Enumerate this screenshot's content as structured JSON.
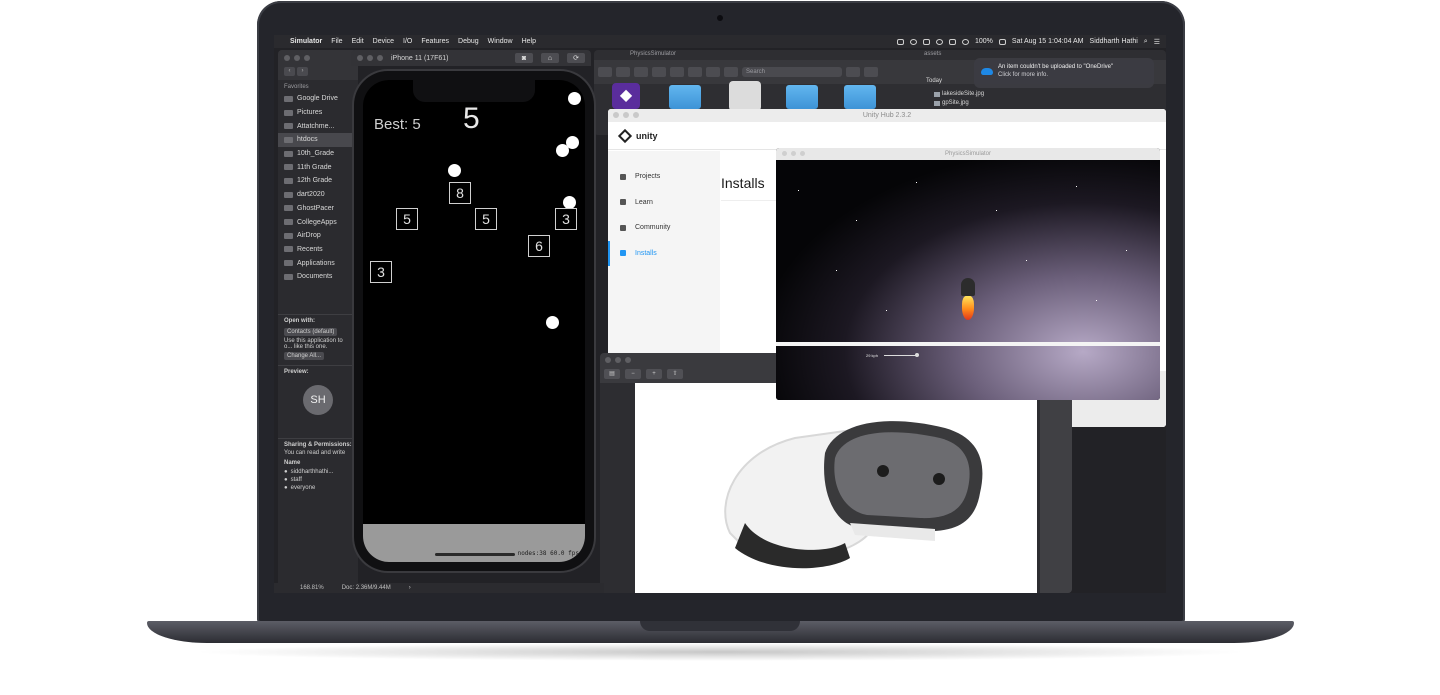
{
  "menubar": {
    "app_name": "Simulator",
    "items": [
      "File",
      "Edit",
      "Device",
      "I/O",
      "Features",
      "Debug",
      "Window",
      "Help"
    ],
    "battery": "100%",
    "datetime": "Sat Aug 15  1:04:04 AM",
    "user": "Siddharth Hathi"
  },
  "simulator": {
    "device_title": "iPhone 11 (17F61)",
    "game": {
      "score": "5",
      "best": "Best: 5",
      "boxes": [
        "8",
        "5",
        "5",
        "3",
        "6",
        "3"
      ],
      "nodes_readout": "nodes:38  60.0 fps"
    }
  },
  "finder_sidebar": {
    "heading": "Favorites",
    "items": [
      "Google Drive",
      "Pictures",
      "Attatchme...",
      "htdocs",
      "10th_Grade",
      "11th Grade",
      "12th Grade",
      "dart2020",
      "GhostPacer",
      "CollegeApps",
      "AirDrop",
      "Recents",
      "Applications",
      "Documents"
    ],
    "open_with_heading": "Open with:",
    "open_with_app": "Contacts (default)",
    "open_with_note": "Use this application to o... like this one.",
    "change_all": "Change All...",
    "preview_heading": "Preview:",
    "avatar_initials": "SH",
    "sharing_heading": "Sharing & Permissions:",
    "sharing_note": "You can read and write",
    "perm_column": "Name",
    "perm_rows": [
      "siddharthhathi...",
      "staff",
      "everyone"
    ]
  },
  "background_finder": {
    "title_physics": "PhysicsSimulator",
    "title_assets": "assets",
    "search_placeholder": "Search",
    "today_label": "Today",
    "files": [
      "lakesideSite.jpg",
      "gpSite.jpg"
    ]
  },
  "notification": {
    "title": "An item couldn't be uploaded to \"OneDrive\"",
    "subtitle": "Click for more info."
  },
  "unity_hub": {
    "window_title": "Unity Hub 2.3.2",
    "brand": "unity",
    "nav": [
      "Projects",
      "Learn",
      "Community",
      "Installs"
    ],
    "active_nav": "Installs",
    "page_title": "Installs"
  },
  "physics_simulator": {
    "window_title": "PhysicsSimulator",
    "slider_label": "29 kph",
    "slider_value_fraction": 0.97
  },
  "preview_window": {
    "status_zoom": "168.81%",
    "status_doc": "Doc: 2.36M/9.44M"
  },
  "colors": {
    "unity_accent": "#2196f3",
    "onedrive_blue": "#1e88e5",
    "folder_blue": "#4aa3e6",
    "vs_purple": "#5a2d9c"
  }
}
